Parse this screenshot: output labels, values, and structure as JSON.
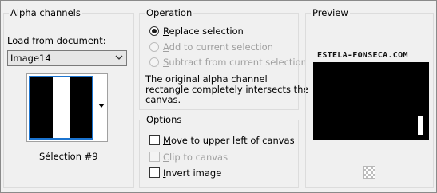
{
  "alpha_channels": {
    "title": "Alpha channels",
    "load_label_pre": "Load from ",
    "load_label_key": "d",
    "load_label_post": "ocument:",
    "document_value": "Image14",
    "selection_name": "Sélection #9"
  },
  "operation": {
    "title": "Operation",
    "options": [
      {
        "key": "R",
        "rest": "eplace selection",
        "checked": true,
        "disabled": false
      },
      {
        "key": "A",
        "rest": "dd to current selection",
        "checked": false,
        "disabled": true
      },
      {
        "key": "S",
        "rest": "ubtract from current selection",
        "checked": false,
        "disabled": true
      }
    ],
    "info_line1": "The original alpha channel",
    "info_line2": "rectangle completely intersects the",
    "info_line3": "canvas."
  },
  "options": {
    "title": "Options",
    "move": {
      "key": "M",
      "rest": "ove to upper left of canvas",
      "checked": false
    },
    "clip": {
      "key": "C",
      "rest": "lip to canvas",
      "checked": false,
      "disabled": true
    },
    "invert": {
      "key": "I",
      "rest": "nvert image",
      "checked": false
    }
  },
  "preview": {
    "title": "Preview",
    "watermark": "ESTELA-FONSECA.COM"
  },
  "colors": {
    "selection_border": "#1b74d0",
    "disabled_text": "#a0a0a0"
  }
}
